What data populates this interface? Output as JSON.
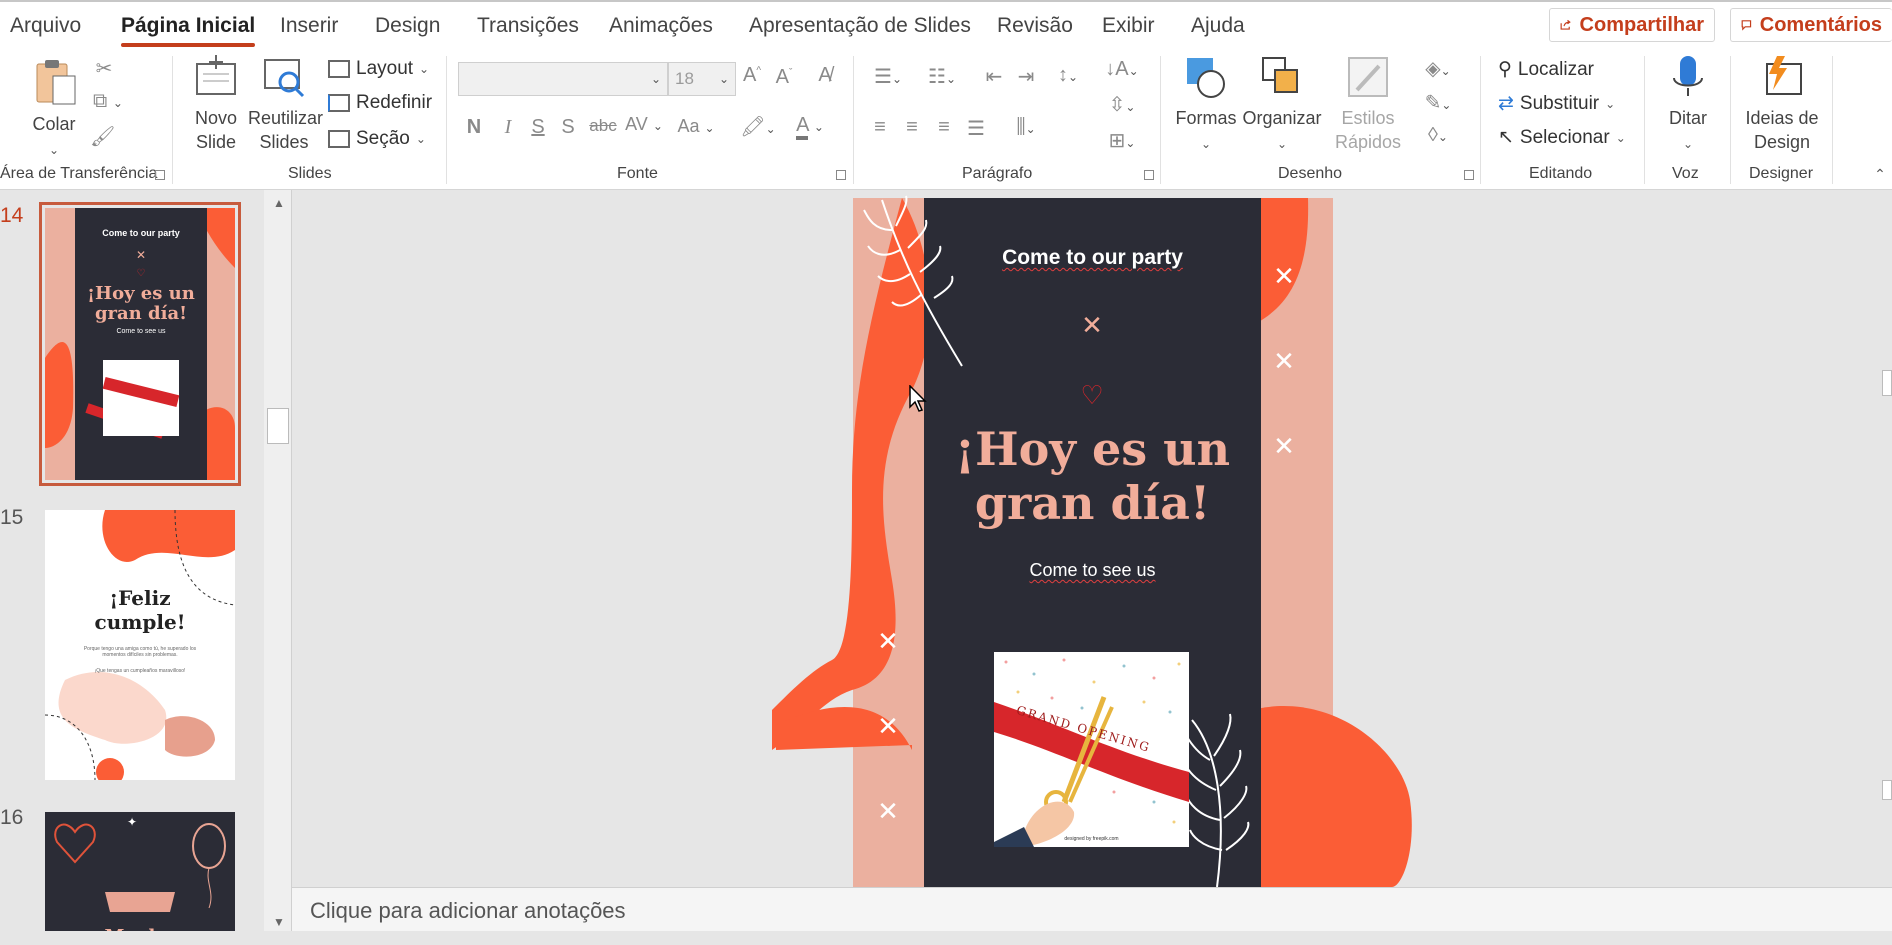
{
  "menu": {
    "tabs": [
      "Arquivo",
      "Página Inicial",
      "Inserir",
      "Design",
      "Transições",
      "Animações",
      "Apresentação de Slides",
      "Revisão",
      "Exibir",
      "Ajuda"
    ],
    "active_tab": "Página Inicial",
    "share_label": "Compartilhar",
    "comments_label": "Comentários"
  },
  "ribbon": {
    "clipboard": {
      "label": "Área de Transferência",
      "paste_label": "Colar"
    },
    "slides": {
      "label": "Slides",
      "new_slide_label": "Novo\nSlide",
      "reuse_label": "Reutilizar\nSlides",
      "layout_label": "Layout",
      "reset_label": "Redefinir",
      "section_label": "Seção"
    },
    "font": {
      "label": "Fonte",
      "font_name": "",
      "font_size": "18",
      "bold": "N",
      "italic": "I",
      "underline": "S",
      "shadow": "S",
      "strike": "abc",
      "spacing": "AV",
      "case": "Aa"
    },
    "paragraph": {
      "label": "Parágrafo"
    },
    "drawing": {
      "label": "Desenho",
      "shapes_label": "Formas",
      "arrange_label": "Organizar",
      "quick_styles_label": "Estilos\nRápidos"
    },
    "editing": {
      "label": "Editando",
      "find_label": "Localizar",
      "replace_label": "Substituir",
      "select_label": "Selecionar"
    },
    "voice": {
      "label": "Voz",
      "dictate_label": "Ditar"
    },
    "designer": {
      "label": "Designer",
      "design_ideas_label": "Ideias de\nDesign"
    }
  },
  "thumbnails": {
    "slides": [
      {
        "number": "14",
        "selected": true,
        "title_small": "Come to our party",
        "headline": "¡Hoy es un\ngran día!",
        "sub": "Come to see us"
      },
      {
        "number": "15",
        "selected": false,
        "headline": "¡Feliz\ncumple!",
        "body": "Porque tengo una amiga como tú, he superado los momentos difíciles sin problemas.",
        "body2": "¡Que tengas un cumpleaños maravilloso!"
      },
      {
        "number": "16",
        "selected": false,
        "headline": "¡Muchas"
      }
    ]
  },
  "slide": {
    "title": "Come to our party",
    "headline": "¡Hoy es un\ngran día!",
    "subtitle": "Come to see us",
    "image_banner_text": "GRAND OPENING",
    "image_credit": "designed by freepik.com"
  },
  "notes_placeholder": "Clique para adicionar anotações",
  "colors": {
    "accent": "#c43e1c",
    "slide_dark": "#2b2c36",
    "slide_orange": "#fb5d36",
    "slide_peach": "#ebb09f",
    "headline": "#f1ad9a"
  }
}
